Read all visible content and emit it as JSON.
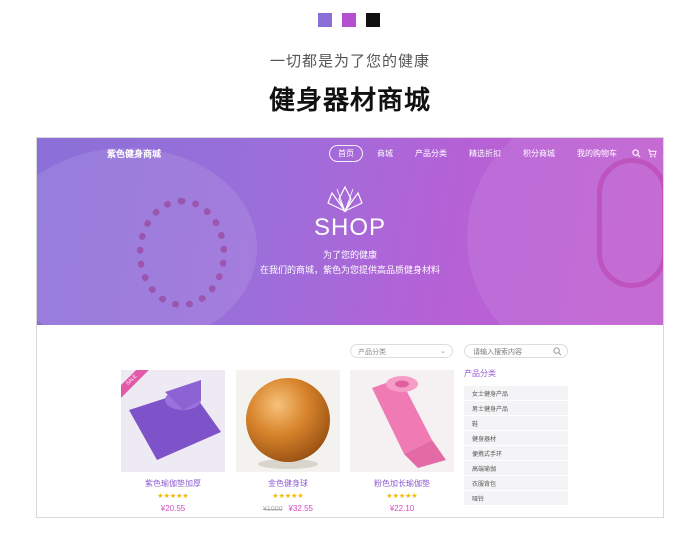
{
  "header": {
    "swatch_colors": [
      "#8b6fd8",
      "#b34fd0",
      "#111111"
    ],
    "subtitle": "一切都是为了您的健康",
    "title": "健身器材商城"
  },
  "site": {
    "brand": "紫色健身商城",
    "nav": [
      "首页",
      "商城",
      "产品分类",
      "精选折扣",
      "积分商城",
      "我的购物车"
    ],
    "nav_icons": [
      "search-icon",
      "cart-icon"
    ]
  },
  "hero": {
    "heading": "SHOP",
    "tagline1": "为了您的健康",
    "tagline2": "在我们的商城，紫色为您提供高品质健身材料"
  },
  "filter": {
    "category_select": "产品分类",
    "search_placeholder": "请输入搜索内容"
  },
  "products": [
    {
      "name": "紫色瑜伽垫加厚",
      "stars": "★★★★★",
      "price": "¥20.55",
      "old_price": "",
      "badge": "SALE"
    },
    {
      "name": "金色健身球",
      "stars": "★★★★★",
      "price": "¥32.55",
      "old_price": "¥1000",
      "badge": ""
    },
    {
      "name": "粉色加长瑜伽垫",
      "stars": "★★★★★",
      "price": "¥22.10",
      "old_price": "",
      "badge": ""
    }
  ],
  "sidebar": {
    "title": "产品分类",
    "categories": [
      "女士健身产品",
      "男士健身产品",
      "鞋",
      "健身器材",
      "便携式手环",
      "高端瑜伽",
      "衣服背包",
      "哑铃"
    ]
  }
}
